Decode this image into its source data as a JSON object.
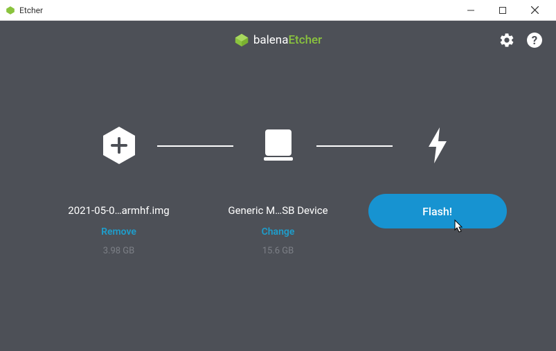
{
  "window": {
    "title": "Etcher"
  },
  "brand": {
    "part1": "balena",
    "part2": "Etcher"
  },
  "steps": {
    "image": {
      "label": "2021-05-0…armhf.img",
      "action": "Remove",
      "size": "3.98 GB"
    },
    "drive": {
      "label": "Generic M…SB Device",
      "action": "Change",
      "size": "15.6 GB"
    },
    "flash": {
      "button": "Flash!"
    }
  }
}
